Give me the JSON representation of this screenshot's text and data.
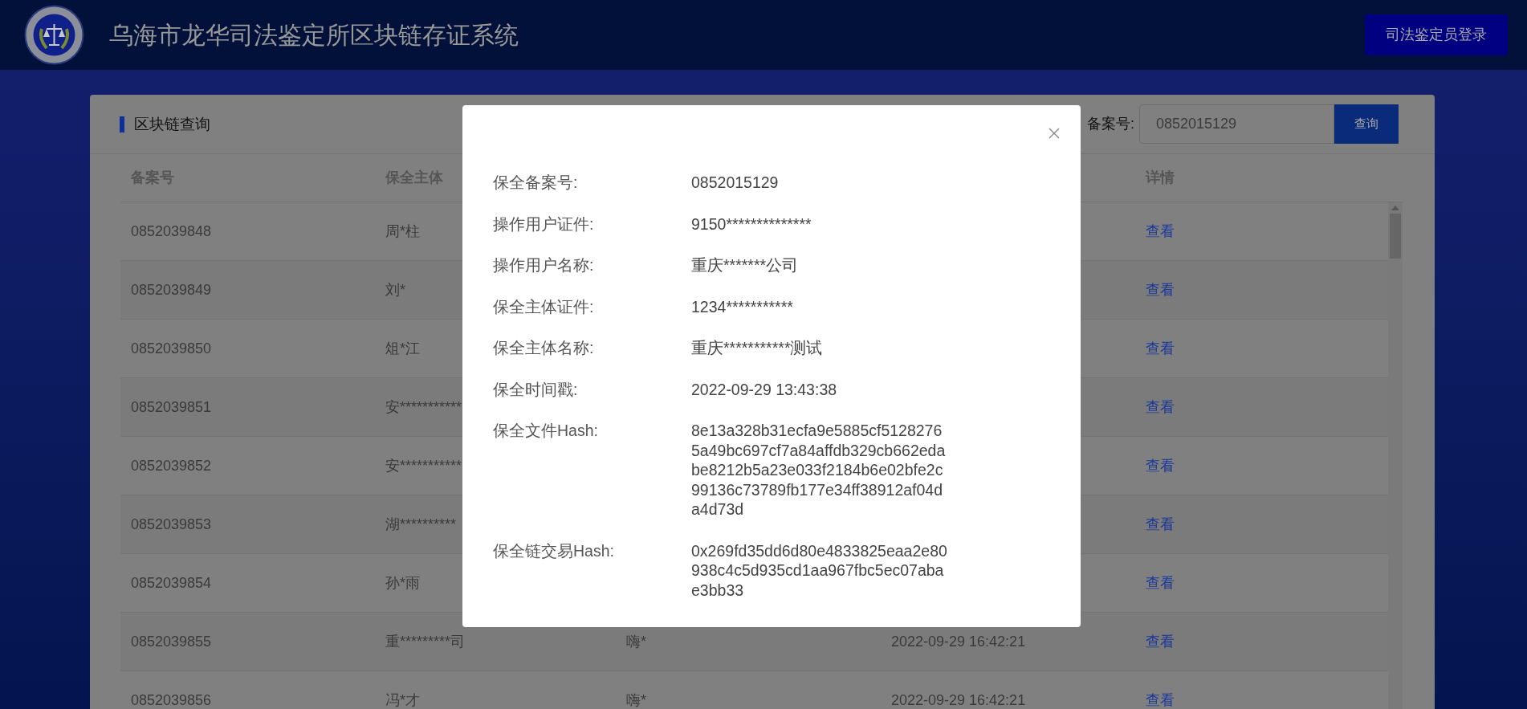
{
  "header": {
    "title": "乌海市龙华司法鉴定所区块链存证系统",
    "login_button": "司法鉴定员登录"
  },
  "query_panel": {
    "title": "区块链查询",
    "search_label": "备案号:",
    "search_value": "0852015129",
    "search_button": "查询"
  },
  "table": {
    "columns": [
      "备案号",
      "保全主体",
      "详情"
    ],
    "rows": [
      {
        "record_no": "0852039848",
        "subject": "周*柱",
        "detail": "查看"
      },
      {
        "record_no": "0852039849",
        "subject": "刘*",
        "detail": "查看"
      },
      {
        "record_no": "0852039850",
        "subject": "俎*江",
        "detail": "查看"
      },
      {
        "record_no": "0852039851",
        "subject": "安***********",
        "detail": "查看"
      },
      {
        "record_no": "0852039852",
        "subject": "安***********",
        "detail": "查看"
      },
      {
        "record_no": "0852039853",
        "subject": "湖**********",
        "detail": "查看"
      },
      {
        "record_no": "0852039854",
        "subject": "孙*雨",
        "detail": "查看"
      },
      {
        "record_no": "0852039855",
        "subject": "重*********司",
        "column_3": "嗨*",
        "time": "2022-09-29 16:42:21",
        "detail": "查看"
      },
      {
        "record_no": "0852039856",
        "subject": "冯*才",
        "column_3": "嗨*",
        "time": "2022-09-29 16:42:21",
        "detail": "查看"
      }
    ]
  },
  "modal": {
    "fields": [
      {
        "label": "保全备案号:",
        "value": "0852015129"
      },
      {
        "label": "操作用户证件:",
        "value": "9150**************"
      },
      {
        "label": "操作用户名称:",
        "value": "重庆*******公司"
      },
      {
        "label": "保全主体证件:",
        "value": "1234***********"
      },
      {
        "label": "保全主体名称:",
        "value": "重庆***********测试"
      },
      {
        "label": "保全时间戳:",
        "value": "2022-09-29 13:43:38"
      },
      {
        "label": "保全文件Hash:",
        "value": "8e13a328b31ecfa9e5885cf51282765a49bc697cf7a84affdb329cb662edabe8212b5a23e033f2184b6e02bfe2c99136c73789fb177e34ff38912af04da4d73d"
      },
      {
        "label": "保全链交易Hash:",
        "value": "0x269fd35dd6d80e4833825eaa2e80938c4c5d935cd1aa967fbc5ec07abae3bb33"
      }
    ]
  }
}
